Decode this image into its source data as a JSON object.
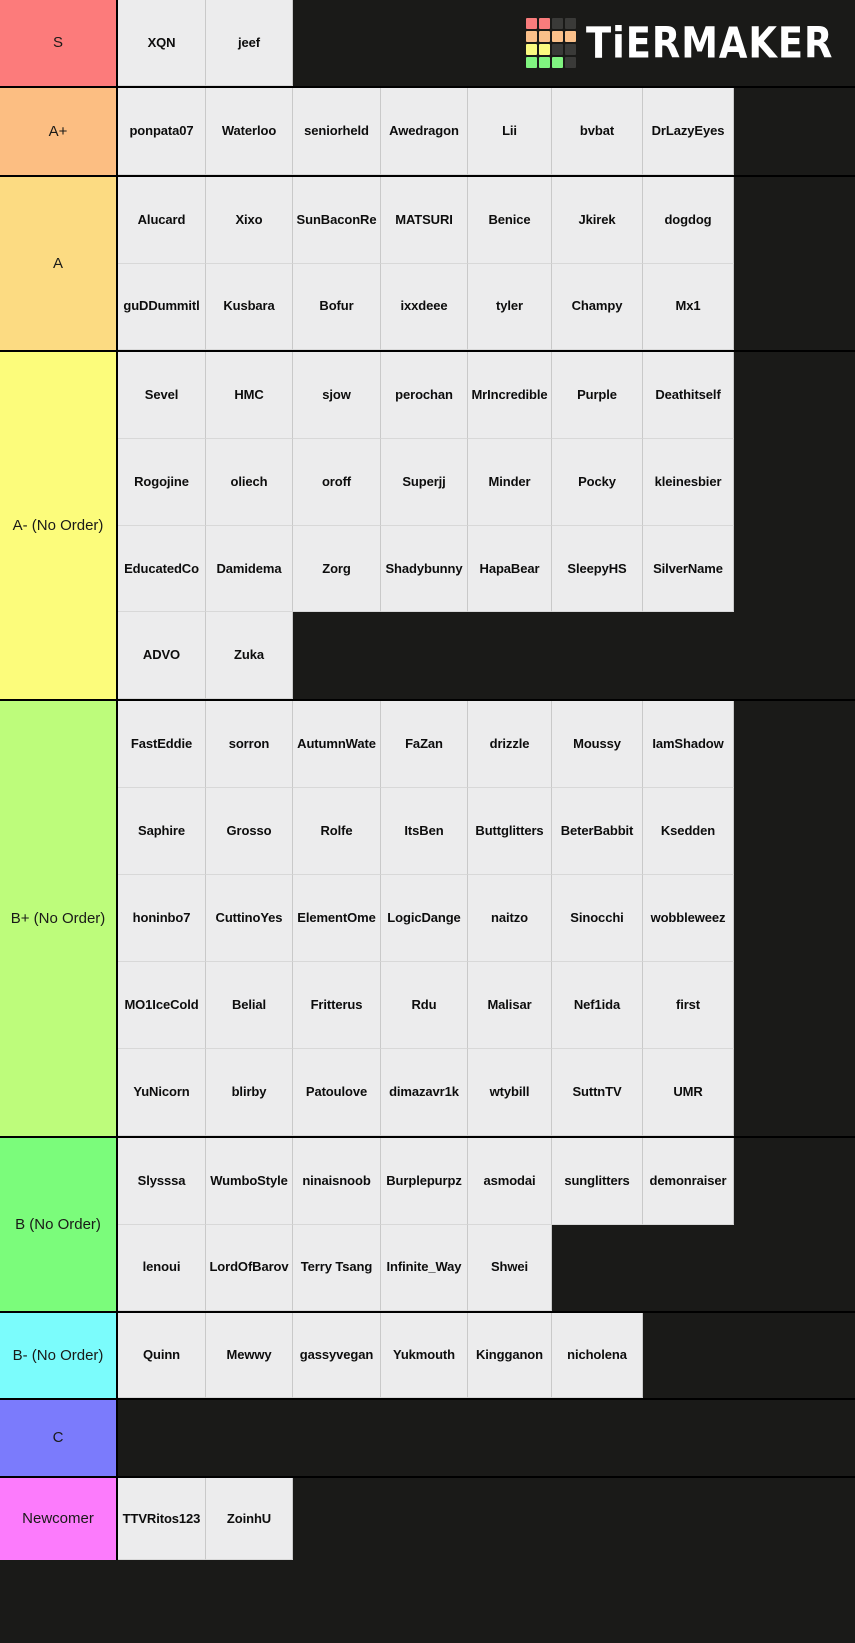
{
  "app": {
    "title": "TierMaker",
    "logo_text": "TiERMAKER",
    "logo_colors": {
      "red": "#f97c7c",
      "orange": "#fac08a",
      "yellow": "#fafa80",
      "green": "#80f480",
      "empty": "#3a3a38"
    },
    "background": "#1a1a18",
    "cell_background": "#ececed"
  },
  "tiers": [
    {
      "label": "S",
      "color": "#fc7b7b",
      "height_class": "h-s",
      "rows": [
        [
          "XQN",
          "jeef"
        ]
      ]
    },
    {
      "label": "A+",
      "color": "#fcbe82",
      "height_class": "h-aplus",
      "rows": [
        [
          "ponpata07",
          "Waterloo",
          "seniorheld",
          "Awedragon",
          "Lii",
          "bvbat",
          "DrLazyEyes"
        ]
      ]
    },
    {
      "label": "A",
      "color": "#fcdb82",
      "height_class": "h-a",
      "rows": [
        [
          "Alucard",
          "Xixo",
          "SunBaconRe",
          "MATSURI",
          "Benice",
          "Jkirek",
          "dogdog"
        ],
        [
          "guDDummitl",
          "Kusbara",
          "Bofur",
          "ixxdeee",
          "tyler",
          "Champy",
          "Mx1"
        ]
      ]
    },
    {
      "label": "A- (No Order)",
      "color": "#fcfc7b",
      "height_class": "h-aminus",
      "rows": [
        [
          "Sevel",
          "HMC",
          "sjow",
          "perochan",
          "MrIncredible",
          "Purple",
          "Deathitself"
        ],
        [
          "Rogojine",
          "oliech",
          "oroff",
          "Superjj",
          "Minder",
          "Pocky",
          "kleinesbier"
        ],
        [
          "EducatedCo",
          "Damidema",
          "Zorg",
          "Shadybunny",
          "HapaBear",
          "SleepyHS",
          "SilverName"
        ],
        [
          "ADVO",
          "Zuka"
        ]
      ]
    },
    {
      "label": "B+ (No Order)",
      "color": "#bdfc7b",
      "height_class": "h-bplus",
      "rows": [
        [
          "FastEddie",
          "sorron",
          "AutumnWate",
          "FaZan",
          "drizzle",
          "Moussy",
          "IamShadow"
        ],
        [
          "Saphire",
          "Grosso",
          "Rolfe",
          "ItsBen",
          "Buttglitters",
          "BeterBabbit",
          "Ksedden"
        ],
        [
          "honinbo7",
          "CuttinoYes",
          "ElementOme",
          "LogicDange",
          "naitzo",
          "Sinocchi",
          "wobbleweez"
        ],
        [
          "MO1IceCold",
          "Belial",
          "Fritterus",
          "Rdu",
          "Malisar",
          "Nef1ida",
          "first"
        ],
        [
          "YuNicorn",
          "blirby",
          "Patoulove",
          "dimazavr1k",
          "wtybill",
          "SuttnTV",
          "UMR"
        ]
      ]
    },
    {
      "label": "B (No Order)",
      "color": "#7bfc7b",
      "height_class": "h-b",
      "rows": [
        [
          "Slysssa",
          "WumboStyle",
          "ninaisnoob",
          "Burplepurpz",
          "asmodai",
          "sunglitters",
          "demonraiser"
        ],
        [
          "lenoui",
          "LordOfBarov",
          "Terry Tsang",
          "Infinite_Way",
          "Shwei"
        ]
      ]
    },
    {
      "label": "B- (No Order)",
      "color": "#7bfcfc",
      "height_class": "h-bminus",
      "rows": [
        [
          "Quinn",
          "Mewwy",
          "gassyvegan",
          "Yukmouth",
          "Kingganon",
          "nicholena"
        ]
      ]
    },
    {
      "label": "C",
      "color": "#7b7bfc",
      "height_class": "h-c",
      "rows": [
        []
      ]
    },
    {
      "label": "Newcomer",
      "color": "#fc7bfc",
      "height_class": "h-new",
      "rows": [
        [
          "TTVRitos123",
          "ZoinhU"
        ]
      ]
    }
  ]
}
